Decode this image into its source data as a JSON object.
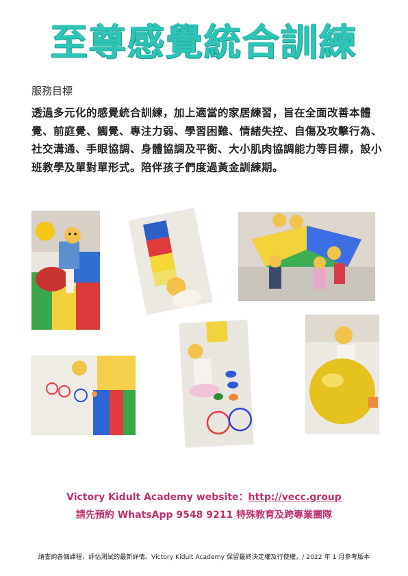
{
  "title": "至尊感覺統合訓練",
  "section_heading": "服務目標",
  "body_text": "透過多元化的感覺統合訓練，加上適當的家居練習，旨在全面改善本體覺、前庭覺、觸覺、專注力弱、學習困難、情緒失控、自傷及攻擊行為、社交溝通、手眼協調、身體協調及平衡、大小肌肉協調能力等目標，設小班教學及單對單形式。陪伴孩子們度過黃金訓練期。",
  "photos": [
    {
      "name": "photo-soft-play-mats"
    },
    {
      "name": "photo-play-tunnel"
    },
    {
      "name": "photo-parachute-game"
    },
    {
      "name": "photo-ring-toss-floor"
    },
    {
      "name": "photo-hoops-and-cones"
    },
    {
      "name": "photo-yellow-exercise-ball"
    }
  ],
  "footer": {
    "website_prefix": "Victory Kidult Academy website：",
    "website_link": "http://vecc.group",
    "contact": "請先預約  WhatsApp 9548 9211  特殊教育及跨專業團隊"
  },
  "fine_print": "請查詢各個課程、評估測試的最新詳情。Victory Kidult Academy  保留最終決定權及行使權。/ 2022 年 1 月參考版本"
}
